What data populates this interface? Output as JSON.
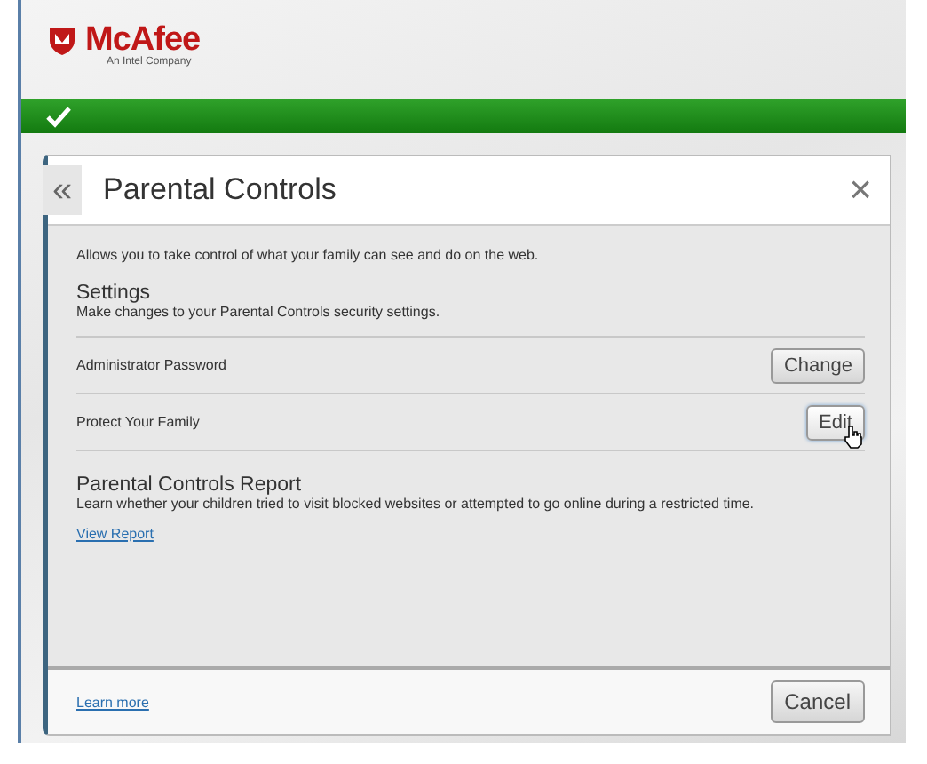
{
  "brand": {
    "name": "McAfee",
    "tagline": "An Intel Company"
  },
  "status": {
    "ok": true
  },
  "panel": {
    "title": "Parental Controls",
    "back": "«",
    "close": "×",
    "intro": "Allows you to take control of what your family can see and do on the web.",
    "settings": {
      "heading": "Settings",
      "description": "Make changes to your Parental Controls security settings.",
      "rows": [
        {
          "label": "Administrator Password",
          "button": "Change",
          "hovered": false
        },
        {
          "label": "Protect Your Family",
          "button": "Edit",
          "hovered": true
        }
      ]
    },
    "report": {
      "heading": "Parental Controls Report",
      "description": "Learn whether your children tried to visit blocked websites or attempted to go online during a restricted time.",
      "link": "View Report"
    },
    "footer": {
      "link": "Learn more",
      "button": "Cancel"
    }
  }
}
